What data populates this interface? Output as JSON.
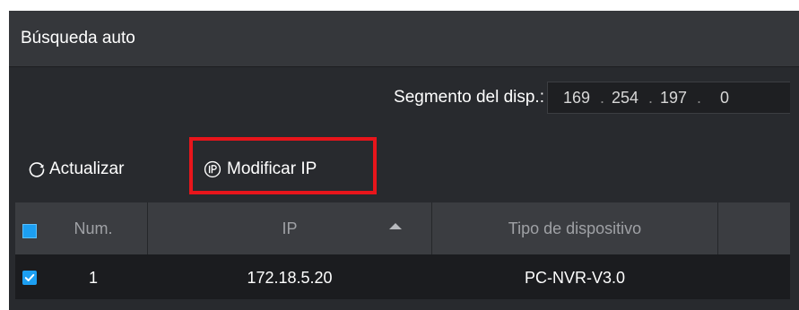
{
  "dialog": {
    "title": "Búsqueda auto"
  },
  "segment": {
    "label": "Segmento del disp.:",
    "octets": [
      "169",
      "254",
      "197",
      "0"
    ],
    "separator": "."
  },
  "toolbar": {
    "refresh_label": "Actualizar",
    "refresh_icon": "refresh-icon",
    "modify_ip_label": "Modificar IP",
    "modify_ip_icon": "ip-icon",
    "highlight_color": "#e8151b"
  },
  "table": {
    "columns": {
      "num": "Num.",
      "ip": "IP",
      "device_type": "Tipo de dispositivo"
    },
    "sort": {
      "column": "IP",
      "direction": "ascending"
    },
    "header_checked": true,
    "rows": [
      {
        "checked": true,
        "num": "1",
        "ip": "172.18.5.20",
        "device_type": "PC-NVR-V3.0"
      }
    ]
  },
  "colors": {
    "background": "#282a2e",
    "title_bar": "#35373b",
    "table_header": "#3b3d41",
    "table_row": "#1b1c1f",
    "checkbox_accent": "#1c9ff2"
  }
}
